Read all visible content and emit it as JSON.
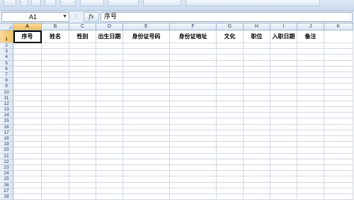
{
  "formula_bar": {
    "name_box": "A1",
    "name_box_arrow": "▼",
    "separator": "⁝",
    "fx_label": "fx",
    "formula_value": "序号"
  },
  "columns": [
    "A",
    "B",
    "C",
    "D",
    "E",
    "F",
    "G",
    "H",
    "I",
    "J",
    "K"
  ],
  "header_row": [
    "序号",
    "姓名",
    "性别",
    "出生日期",
    "身份证号码",
    "身份证地址",
    "文化",
    "职位",
    "入职日期",
    "备注",
    ""
  ],
  "row_numbers": [
    "1",
    "2",
    "3",
    "4",
    "5",
    "6",
    "7",
    "8",
    "9",
    "10",
    "11",
    "12",
    "13",
    "14",
    "15",
    "16",
    "17",
    "18",
    "19",
    "20",
    "21",
    "22",
    "23",
    "24",
    "25",
    "26",
    "27",
    "28"
  ]
}
